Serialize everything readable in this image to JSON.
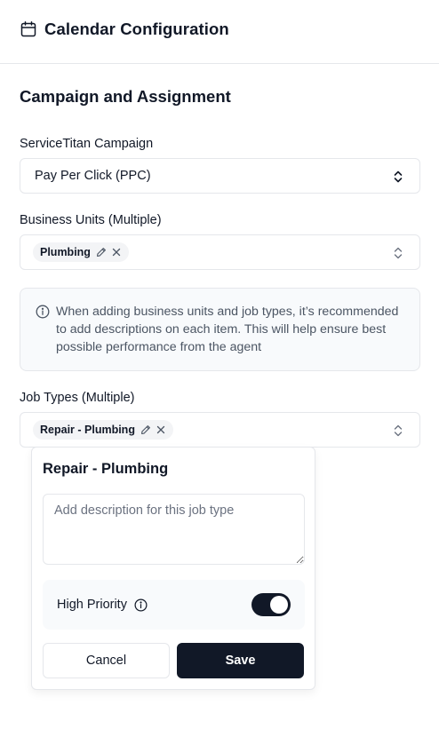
{
  "header": {
    "title": "Calendar Configuration",
    "icon": "calendar-icon"
  },
  "section": {
    "title": "Campaign and Assignment"
  },
  "campaign": {
    "label": "ServiceTitan Campaign",
    "value": "Pay Per Click (PPC)"
  },
  "business_units": {
    "label": "Business Units (Multiple)",
    "chips": [
      {
        "label": "Plumbing"
      }
    ]
  },
  "info": {
    "text": "When adding business units and job types, it’s recommended to add descriptions on each item. This will help ensure best possible performance from the agent"
  },
  "job_types": {
    "label": "Job Types (Multiple)",
    "chips": [
      {
        "label": "Repair - Plumbing"
      }
    ]
  },
  "popover": {
    "title": "Repair - Plumbing",
    "description_placeholder": "Add description for this job type",
    "description_value": "",
    "priority_label": "High Priority",
    "priority_on": true,
    "cancel_label": "Cancel",
    "save_label": "Save"
  },
  "colors": {
    "primary": "#111827",
    "border": "#e5e7eb",
    "muted_bg": "#f8fafc",
    "muted_text": "#4b5563"
  }
}
